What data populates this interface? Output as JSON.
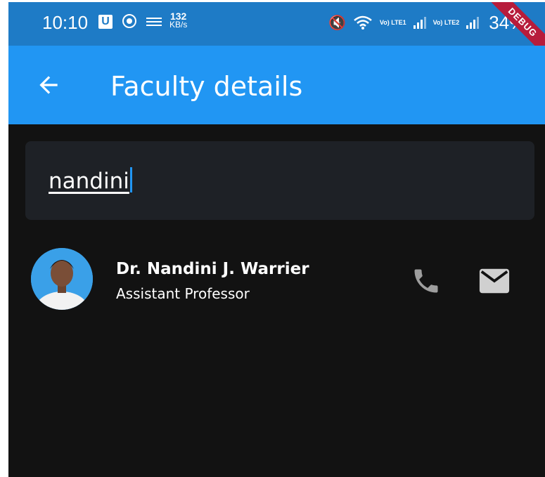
{
  "status_bar": {
    "time": "10:10",
    "u_badge": "U",
    "net_speed_value": "132",
    "net_speed_unit": "KB/s",
    "sim1_label": "Vo) LTE1",
    "sim2_label": "Vo) LTE2",
    "battery": "34%",
    "icons": [
      "u-icon",
      "vpn-circle-icon",
      "keyboard-icon",
      "mute-icon",
      "wifi-icon",
      "signal-icon",
      "signal-icon",
      "battery-icon"
    ]
  },
  "debug_banner": "DEBUG",
  "app_bar": {
    "title": "Faculty details",
    "back_icon": "arrow-left-icon",
    "color": "#2196f3"
  },
  "search": {
    "value": "nandini"
  },
  "results": [
    {
      "name": "Dr. Nandini J. Warrier",
      "designation": "Assistant Professor",
      "actions": [
        "phone-icon",
        "mail-icon"
      ]
    }
  ],
  "colors": {
    "background": "#121212",
    "status_bar": "#1e7bc6",
    "search_field": "#1e2126",
    "action_icon": "#9e9e9e",
    "debug": "#b71c3b"
  }
}
